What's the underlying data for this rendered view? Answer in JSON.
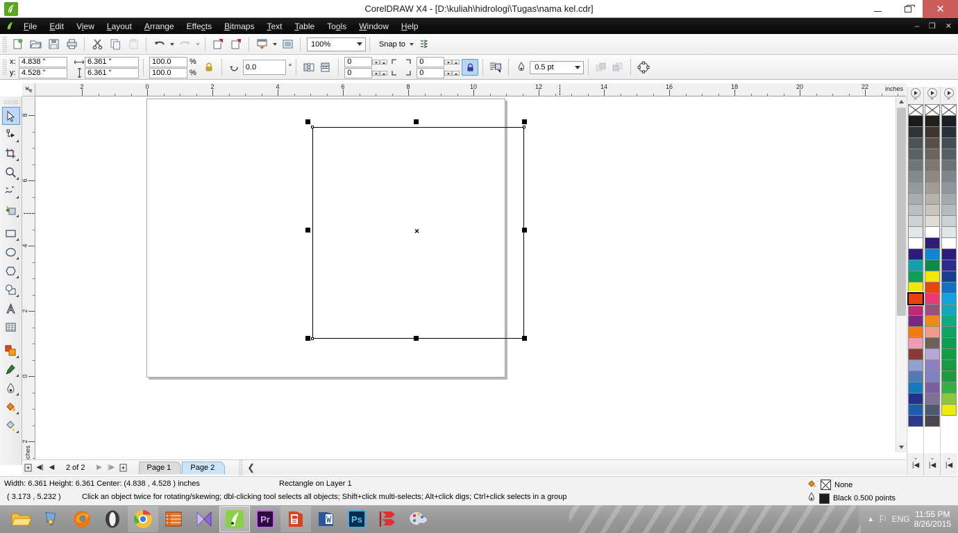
{
  "window": {
    "title": "CorelDRAW X4 - [D:\\kuliah\\hidrologi\\Tugas\\nama kel.cdr]",
    "app_icon": "coreldraw-icon",
    "minimize": "minimize-button",
    "maximize": "maximize-button",
    "close": "close-button"
  },
  "menu": {
    "items": [
      {
        "label": "File"
      },
      {
        "label": "Edit"
      },
      {
        "label": "View"
      },
      {
        "label": "Layout"
      },
      {
        "label": "Arrange"
      },
      {
        "label": "Effects"
      },
      {
        "label": "Bitmaps"
      },
      {
        "label": "Text"
      },
      {
        "label": "Table"
      },
      {
        "label": "Tools"
      },
      {
        "label": "Window"
      },
      {
        "label": "Help"
      }
    ],
    "doc_minimize": "–",
    "doc_restore": "❐",
    "doc_close": "✕"
  },
  "toolbar": {
    "buttons": [
      {
        "name": "new-document",
        "label": "New"
      },
      {
        "name": "open-document",
        "label": "Open"
      },
      {
        "name": "save-document",
        "label": "Save"
      },
      {
        "name": "print-document",
        "label": "Print"
      },
      {
        "name": "cut",
        "label": "Cut"
      },
      {
        "name": "copy",
        "label": "Copy"
      },
      {
        "name": "paste",
        "label": "Paste"
      },
      {
        "name": "undo",
        "label": "Undo"
      },
      {
        "name": "redo",
        "label": "Redo"
      },
      {
        "name": "import",
        "label": "Import"
      },
      {
        "name": "export",
        "label": "Export"
      },
      {
        "name": "launch-app",
        "label": "Application Launcher"
      },
      {
        "name": "corel-online",
        "label": "Corel Online"
      }
    ],
    "zoom_level": "100%",
    "snap_to": "Snap to",
    "options_label": "Options"
  },
  "property_bar": {
    "x_label": "x:",
    "y_label": "y:",
    "x_value": "4.838 \"",
    "y_value": "4.528 \"",
    "width_value": "6.361 \"",
    "height_value": "6.361 \"",
    "scale_h": "100.0",
    "scale_v": "100.0",
    "percent": "%",
    "lock_ratio": "lock-ratio-icon",
    "rotation": "0.0",
    "degree": "°",
    "mirror_h": "mirror-horizontal-button",
    "mirror_v": "mirror-vertical-button",
    "corner_tl": "0",
    "corner_bl": "0",
    "corner_tr": "0",
    "corner_br": "0",
    "round_lock": "round-corners-lock-button",
    "wrap_text": "wrap-paragraph-text-button",
    "outline_width": "0.5 pt",
    "to_front": "to-front-button",
    "to_back": "to-back-button",
    "convert_curves": "convert-to-curves-button"
  },
  "rulers": {
    "unit": "inches",
    "h_ticks": [
      "2",
      "0",
      "2",
      "4",
      "6",
      "8",
      "10",
      "12",
      "14",
      "16",
      "18",
      "20",
      "22"
    ],
    "v_ticks": [
      "8",
      "6",
      "4",
      "2",
      "0",
      "2"
    ]
  },
  "toolbox": {
    "tools": [
      {
        "name": "pick-tool",
        "label": "Pick",
        "selected": true,
        "flyout": false
      },
      {
        "name": "shape-tool",
        "label": "Shape",
        "selected": false,
        "flyout": true
      },
      {
        "name": "crop-tool",
        "label": "Crop",
        "selected": false,
        "flyout": true
      },
      {
        "name": "zoom-tool",
        "label": "Zoom",
        "selected": false,
        "flyout": true
      },
      {
        "name": "freehand-tool",
        "label": "Freehand",
        "selected": false,
        "flyout": true
      },
      {
        "name": "smart-fill-tool",
        "label": "Smart Fill",
        "selected": false,
        "flyout": true
      },
      {
        "name": "rectangle-tool",
        "label": "Rectangle",
        "selected": false,
        "flyout": true
      },
      {
        "name": "ellipse-tool",
        "label": "Ellipse",
        "selected": false,
        "flyout": true
      },
      {
        "name": "polygon-tool",
        "label": "Polygon",
        "selected": false,
        "flyout": true
      },
      {
        "name": "basic-shapes-tool",
        "label": "Basic Shapes",
        "selected": false,
        "flyout": true
      },
      {
        "name": "text-tool",
        "label": "Text",
        "selected": false,
        "flyout": false
      },
      {
        "name": "table-tool",
        "label": "Table",
        "selected": false,
        "flyout": false
      },
      {
        "name": "blend-tool",
        "label": "Interactive Blend",
        "selected": false,
        "flyout": true
      },
      {
        "name": "eyedropper-tool",
        "label": "Eyedropper",
        "selected": false,
        "flyout": true
      },
      {
        "name": "outline-tool",
        "label": "Outline",
        "selected": false,
        "flyout": true
      },
      {
        "name": "fill-tool",
        "label": "Fill",
        "selected": false,
        "flyout": true
      },
      {
        "name": "interactive-fill-tool",
        "label": "Interactive Fill",
        "selected": false,
        "flyout": true
      }
    ]
  },
  "document": {
    "selected_object": "rectangle",
    "handle_count": 8,
    "center_marker": "×"
  },
  "page_nav": {
    "add_page_start": "add-page-before-button",
    "first": "◀|",
    "prev": "◀",
    "counter": "2 of 2",
    "next": "▶",
    "last": "|▶",
    "add_page_end": "add-page-after-button",
    "tabs": [
      {
        "label": "Page 1",
        "active": false
      },
      {
        "label": "Page 2",
        "active": true
      }
    ]
  },
  "status_bar": {
    "dimensions": "Width: 6.361  Height: 6.361  Center: (4.838 , 4.528 )  inches",
    "object_info": "Rectangle on Layer 1",
    "cursor_pos": "( 3.173 , 5.232 )",
    "hint": "Click an object twice for rotating/skewing; dbl-clicking tool selects all objects; Shift+click multi-selects; Alt+click digs; Ctrl+click selects in a group",
    "fill_label": "None",
    "fill_icon": "fill-bucket-icon",
    "outline_label": "Black  0.500 points",
    "outline_icon": "outline-pen-icon"
  },
  "palette": {
    "columns": [
      {
        "name": "palette-column-1",
        "swatches": [
          "none",
          "#1a1a1a",
          "#2f3437",
          "#4b5356",
          "#5b6266",
          "#6f767a",
          "#838a8e",
          "#949a9e",
          "#a7adb1",
          "#b9bfc3",
          "#cdd2d6",
          "#e3e7ea",
          "#ffffff",
          "#2e1b7a",
          "#12a0ac",
          "#0f9d58",
          "#efe80f",
          "#e8430f",
          "#bb2a72",
          "#7a2484",
          "#ef7d10",
          "#ef9bb4",
          "#8a3b38",
          "#92a0cd",
          "#5878b4",
          "#1878be",
          "#23308e",
          "#1c5fa8",
          "#2d3a8c"
        ],
        "selected_index": 17
      },
      {
        "name": "palette-column-2",
        "swatches": [
          "none",
          "#23201c",
          "#3b352f",
          "#585048",
          "#6b645c",
          "#7d7770",
          "#8e8880",
          "#a29c95",
          "#b6b1aa",
          "#c9c5bf",
          "#dedbd6",
          "#ffffff",
          "#2e1b7a",
          "#1186d8",
          "#0f8a49",
          "#f0e707",
          "#e8470c",
          "#ea3876",
          "#9a5378",
          "#ef8a18",
          "#f2988d",
          "#6f6158",
          "#b5a8d8",
          "#8c80c4",
          "#7d82c0",
          "#7a5fa5",
          "#7a7194",
          "#4f5a72",
          "#4a4550"
        ],
        "selected_index": -1
      },
      {
        "name": "palette-column-3",
        "swatches": [
          "none",
          "#1a1f26",
          "#2b3138",
          "#454d54",
          "#575f66",
          "#6b7379",
          "#7e868c",
          "#8f979d",
          "#a2a9af",
          "#b5bcc1",
          "#cbd1d5",
          "#e1e6e9",
          "#ffffff",
          "#2e1b7a",
          "#2b2a8e",
          "#1e3c8c",
          "#1470c4",
          "#17a0e0",
          "#13a8bd",
          "#10a87f",
          "#0fa363",
          "#0f9d50",
          "#149b46",
          "#179a42",
          "#1f9a3e",
          "#3aad46",
          "#8dc63f",
          "#ecec0f"
        ],
        "selected_index": -1
      }
    ],
    "scroll_up": "⌃",
    "scroll_down": "⌄",
    "home": "|◀",
    "play": "palette-expand-icon"
  },
  "taskbar": {
    "items": [
      {
        "name": "file-explorer",
        "label": "File Explorer",
        "active": false
      },
      {
        "name": "internet-download-manager",
        "label": "IDM",
        "active": false
      },
      {
        "name": "firefox",
        "label": "Mozilla Firefox",
        "active": false
      },
      {
        "name": "opera",
        "label": "Opera",
        "active": false
      },
      {
        "name": "google-chrome",
        "label": "Google Chrome",
        "active": false,
        "hl": true
      },
      {
        "name": "media-player",
        "label": "Media Player",
        "active": false
      },
      {
        "name": "video-converter",
        "label": "Converter",
        "active": false
      },
      {
        "name": "coreldraw",
        "label": "CorelDRAW X4",
        "active": true
      },
      {
        "name": "adobe-premiere",
        "label": "Pr",
        "active": false
      },
      {
        "name": "powerpoint",
        "label": "P",
        "active": false,
        "hl": true
      },
      {
        "name": "word",
        "label": "W",
        "active": false
      },
      {
        "name": "photoshop",
        "label": "Ps",
        "active": false
      },
      {
        "name": "sketchup",
        "label": "SketchUp",
        "active": false
      },
      {
        "name": "paint",
        "label": "Paint",
        "active": false
      }
    ],
    "tray": {
      "show_hidden": "show-hidden-icons-icon",
      "language_flag": "language-flag-icon",
      "language": "ENG",
      "time": "11:55 PM",
      "date": "8/26/2015"
    }
  }
}
